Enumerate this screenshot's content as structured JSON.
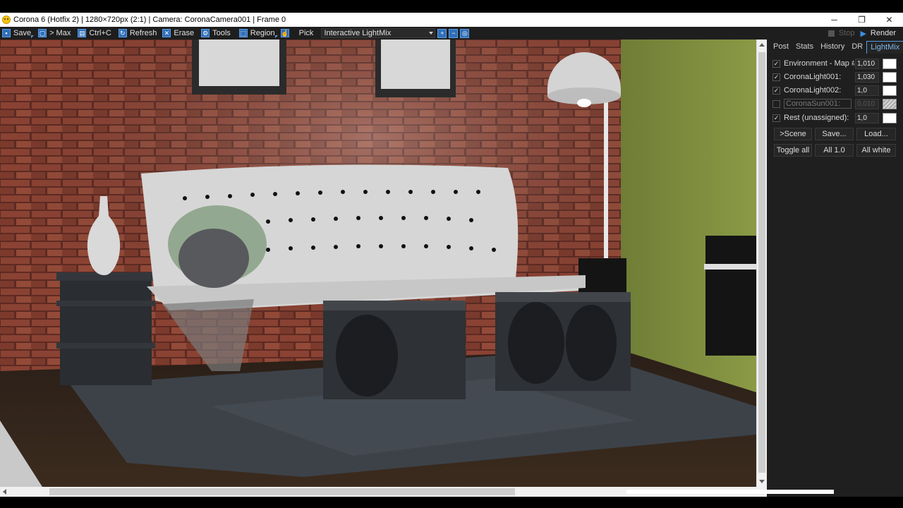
{
  "window": {
    "title": "Corona 6 (Hotfix 2) | 1280×720px (2:1) | Camera: CoronaCamera001 | Frame 0",
    "minimize": "─",
    "restore": "❐",
    "close": "✕"
  },
  "toolbar": {
    "save": "Save",
    "max": "> Max",
    "copy": "Ctrl+C",
    "refresh": "Refresh",
    "erase": "Erase",
    "tools": "Tools",
    "region": "Region",
    "pick": "Pick",
    "channel": "Interactive LightMix",
    "stop": "Stop",
    "render": "Render",
    "play_icon": "▶"
  },
  "panel": {
    "tabs": [
      "Post",
      "Stats",
      "History",
      "DR",
      "LightMix"
    ],
    "active_tab": "LightMix",
    "lights": [
      {
        "name": "Environment - Map #",
        "value": "1,010",
        "checked": true,
        "enabled": true
      },
      {
        "name": "CoronaLight001:",
        "value": "1,030",
        "checked": true,
        "enabled": true
      },
      {
        "name": "CoronaLight002:",
        "value": "1,0",
        "checked": true,
        "enabled": true
      },
      {
        "name": "CoronaSun001:",
        "value": "0,010",
        "checked": false,
        "enabled": false
      },
      {
        "name": "Rest (unassigned):",
        "value": "1,0",
        "checked": true,
        "enabled": true
      }
    ],
    "buttons": {
      "scene": ">Scene",
      "save": "Save...",
      "load": "Load...",
      "toggle_all": "Toggle all",
      "all_one": "All 1.0",
      "all_white": "All white"
    },
    "check_mark": "✓"
  },
  "colors": {
    "accent": "#3b8fe0",
    "panel_bg": "#1f1f1f",
    "toolbar_bg": "#1e1e1e",
    "brick": "#7a3a2c",
    "green_wall": "#7a8a3a"
  }
}
